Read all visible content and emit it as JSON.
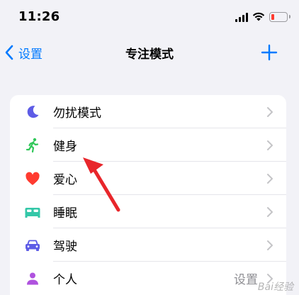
{
  "status_bar": {
    "time": "11:26"
  },
  "nav": {
    "back_label": "设置",
    "title": "专注模式",
    "add_icon": "plus-icon"
  },
  "focus_modes": [
    {
      "label": "勿扰模式",
      "icon": "moon-icon",
      "color": "#5e5ce6",
      "detail": ""
    },
    {
      "label": "健身",
      "icon": "running-figure-icon",
      "color": "#30c759",
      "detail": ""
    },
    {
      "label": "爱心",
      "icon": "heart-icon",
      "color": "#ff3b30",
      "detail": ""
    },
    {
      "label": "睡眠",
      "icon": "bed-icon",
      "color": "#34c7a8",
      "detail": ""
    },
    {
      "label": "驾驶",
      "icon": "car-icon",
      "color": "#5e5ce6",
      "detail": ""
    },
    {
      "label": "个人",
      "icon": "person-icon",
      "color": "#af52de",
      "detail": "设置"
    }
  ],
  "colors": {
    "accent": "#007aff",
    "annotation": "#e8262b",
    "battery_low": "#ff3b30"
  },
  "watermark": "Bai经验"
}
